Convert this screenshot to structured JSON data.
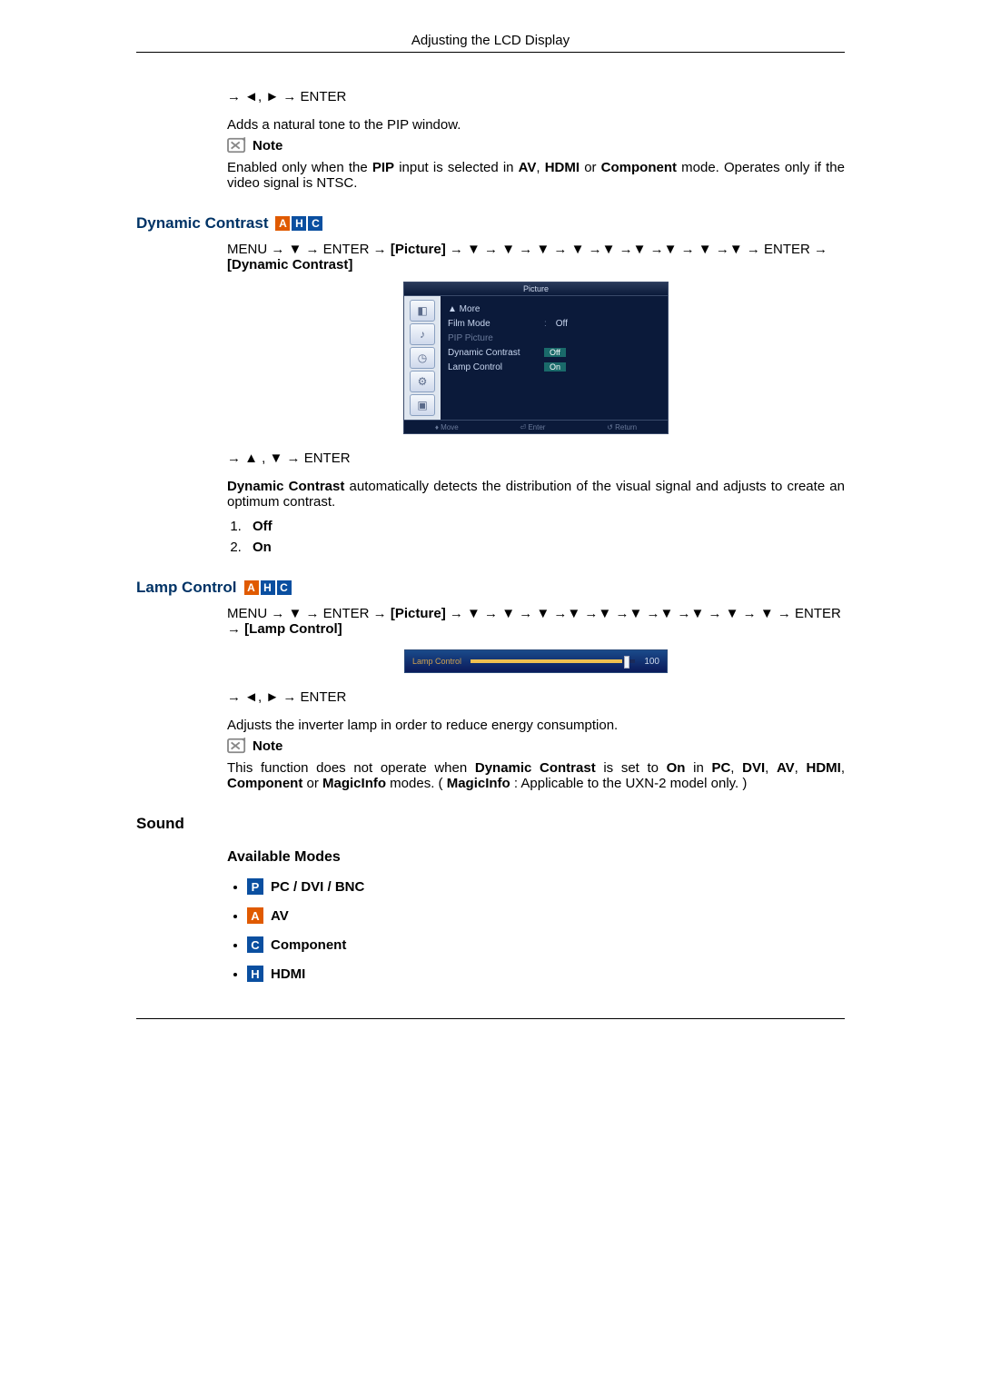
{
  "header": {
    "title": "Adjusting the LCD Display"
  },
  "sec_pip": {
    "nav": "→ ◄, ► → ENTER",
    "desc": "Adds a natural tone to the PIP window.",
    "note_label": "Note",
    "note_text_1": "Enabled only when the ",
    "note_pip": "PIP",
    "note_text_2": " input is selected in ",
    "note_av": "AV",
    "note_text_3": ", ",
    "note_hdmi": "HDMI",
    "note_text_4": " or ",
    "note_comp": "Component",
    "note_text_5": " mode. Operates only if the video signal is NTSC."
  },
  "sec_dc": {
    "title": "Dynamic Contrast",
    "badges": [
      "A",
      "H",
      "C"
    ],
    "nav_pre": "MENU → ▼ → ENTER → ",
    "nav_pic": "[Picture]",
    "nav_mid": " → ▼ → ▼ → ▼ → ▼ →▼ →▼ →▼ → ▼ →▼ → ENTER → ",
    "nav_end": "[Dynamic Contrast]",
    "osd": {
      "title": "Picture",
      "more": "▲ More",
      "rows": [
        {
          "label": "Film Mode",
          "value": "Off",
          "box": false,
          "dim": false
        },
        {
          "label": "PIP Picture",
          "value": "",
          "box": false,
          "dim": true
        },
        {
          "label": "Dynamic Contrast",
          "value": "Off",
          "box": true,
          "dim": false
        },
        {
          "label": "Lamp Control",
          "value": "On",
          "box": true,
          "dim": false
        }
      ],
      "foot": {
        "move": "♦ Move",
        "enter": "⏎ Enter",
        "ret": "↺ Return"
      },
      "side_icons": [
        "picture-icon",
        "sound-icon",
        "setup-icon",
        "settings-icon",
        "multi-icon"
      ]
    },
    "nav2": "→ ▲ , ▼ → ENTER",
    "desc_b": "Dynamic Contrast",
    "desc_rest": " automatically detects the distribution of the visual signal and adjusts to create an optimum contrast.",
    "opts": [
      "Off",
      "On"
    ]
  },
  "sec_lc": {
    "title": "Lamp Control",
    "badges": [
      "A",
      "H",
      "C"
    ],
    "nav_pre": "MENU → ▼ → ENTER → ",
    "nav_pic": "[Picture]",
    "nav_mid": " → ▼ → ▼ → ▼ →▼ →▼ →▼ →▼ →▼ → ▼ → ▼ → ENTER → ",
    "nav_end": "[Lamp Control]",
    "osd": {
      "label": "Lamp Control",
      "value": "100"
    },
    "nav2": "→ ◄, ► → ENTER",
    "desc": "Adjusts the inverter lamp in order to reduce energy consumption.",
    "note_label": "Note",
    "note_1": "This function does not operate when ",
    "note_dc": "Dynamic Contrast",
    "note_2": " is set to ",
    "note_on": "On",
    "note_3": " in ",
    "note_pc": "PC",
    "note_4": ", ",
    "note_dvi": "DVI",
    "note_5": ", ",
    "note_av": "AV",
    "note_6": ", ",
    "note_hdmi": "HDMI",
    "note_7": ", ",
    "note_comp": "Component",
    "note_8": " or ",
    "note_mi": "MagicInfo",
    "note_9": " modes. ( ",
    "note_mi2": "MagicInfo",
    "note_10": " : Applicable to the UXN-2 model only. )"
  },
  "sec_sound": {
    "title": "Sound",
    "sub": "Available Modes",
    "modes": [
      {
        "badge": "P",
        "cls": "P",
        "label": "PC / DVI / BNC"
      },
      {
        "badge": "A",
        "cls": "A",
        "label": "AV"
      },
      {
        "badge": "C",
        "cls": "C",
        "label": "Component"
      },
      {
        "badge": "H",
        "cls": "H",
        "label": "HDMI"
      }
    ]
  }
}
